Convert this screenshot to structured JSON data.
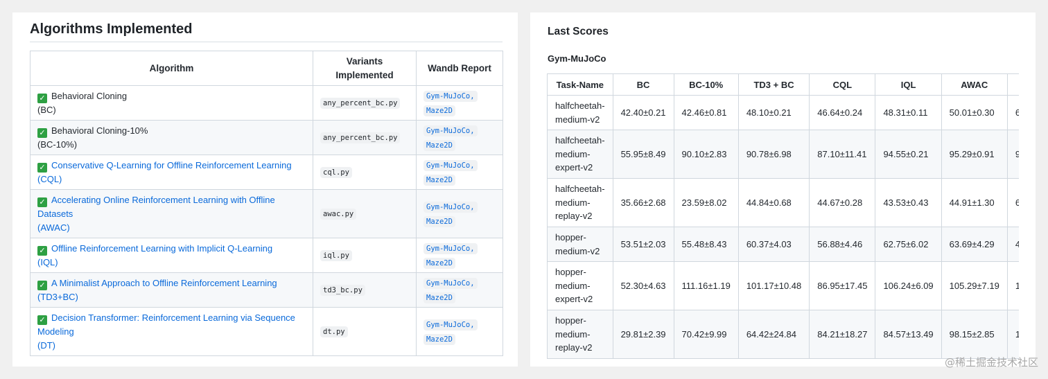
{
  "left": {
    "title": "Algorithms Implemented",
    "headers": {
      "algorithm": "Algorithm",
      "variants": "Variants Implemented",
      "report": "Wandb Report"
    },
    "rows": [
      {
        "lines": [
          "Behavioral Cloning"
        ],
        "abbr": "(BC)",
        "link": false,
        "variant": "any_percent_bc.py",
        "report1": "Gym-MuJoCo,",
        "report2": "Maze2D"
      },
      {
        "lines": [
          "Behavioral Cloning-10%"
        ],
        "abbr": "(BC-10%)",
        "link": false,
        "variant": "any_percent_bc.py",
        "report1": "Gym-MuJoCo,",
        "report2": "Maze2D"
      },
      {
        "lines": [
          "Conservative Q-Learning for Offline Reinforcement Learning"
        ],
        "abbr": "(CQL)",
        "link": true,
        "variant": "cql.py",
        "report1": "Gym-MuJoCo,",
        "report2": "Maze2D"
      },
      {
        "lines": [
          "Accelerating Online Reinforcement Learning with Offline",
          "Datasets"
        ],
        "abbr": "(AWAC)",
        "link": true,
        "variant": "awac.py",
        "report1": "Gym-MuJoCo,",
        "report2": "Maze2D"
      },
      {
        "lines": [
          "Offline Reinforcement Learning with Implicit Q-Learning"
        ],
        "abbr": "(IQL)",
        "link": true,
        "variant": "iql.py",
        "report1": "Gym-MuJoCo,",
        "report2": "Maze2D"
      },
      {
        "lines": [
          "A Minimalist Approach to Offline Reinforcement Learning"
        ],
        "abbr": "(TD3+BC)",
        "link": true,
        "variant": "td3_bc.py",
        "report1": "Gym-MuJoCo,",
        "report2": "Maze2D"
      },
      {
        "lines": [
          "Decision Transformer: Reinforcement Learning via Sequence",
          "Modeling"
        ],
        "abbr": "(DT)",
        "link": true,
        "variant": "dt.py",
        "report1": "Gym-MuJoCo,",
        "report2": "Maze2D"
      }
    ],
    "check_glyph": "✓"
  },
  "right": {
    "title": "Last Scores",
    "subtitle": "Gym-MuJoCo",
    "columns": [
      "Task-Name",
      "BC",
      "BC-10%",
      "TD3 + BC",
      "CQL",
      "IQL",
      "AWAC",
      ""
    ],
    "rows": [
      {
        "task": [
          "halfcheetah-",
          "medium-v2"
        ],
        "vals": [
          "42.40±0.21",
          "42.46±0.81",
          "48.10±0.21",
          "46.64±0.24",
          "48.31±0.11",
          "50.01±0.30",
          "6"
        ]
      },
      {
        "task": [
          "halfcheetah-",
          "medium-",
          "expert-v2"
        ],
        "vals": [
          "55.95±8.49",
          "90.10±2.83",
          "90.78±6.98",
          "87.10±11.41",
          "94.55±0.21",
          "95.29±0.91",
          "9"
        ]
      },
      {
        "task": [
          "halfcheetah-",
          "medium-",
          "replay-v2"
        ],
        "vals": [
          "35.66±2.68",
          "23.59±8.02",
          "44.84±0.68",
          "44.67±0.28",
          "43.53±0.43",
          "44.91±1.30",
          "6"
        ]
      },
      {
        "task": [
          "hopper-",
          "medium-v2"
        ],
        "vals": [
          "53.51±2.03",
          "55.48±8.43",
          "60.37±4.03",
          "56.88±4.46",
          "62.75±6.02",
          "63.69±4.29",
          "4"
        ]
      },
      {
        "task": [
          "hopper-",
          "medium-",
          "expert-v2"
        ],
        "vals": [
          "52.30±4.63",
          "111.16±1.19",
          "101.17±10.48",
          "86.95±17.45",
          "106.24±6.09",
          "105.29±7.19",
          "1"
        ]
      },
      {
        "task": [
          "hopper-",
          "medium-",
          "replay-v2"
        ],
        "vals": [
          "29.81±2.39",
          "70.42±9.99",
          "64.42±24.84",
          "84.21±18.27",
          "84.57±13.49",
          "98.15±2.85",
          "1"
        ]
      }
    ]
  },
  "watermark": "@稀土掘金技术社区"
}
